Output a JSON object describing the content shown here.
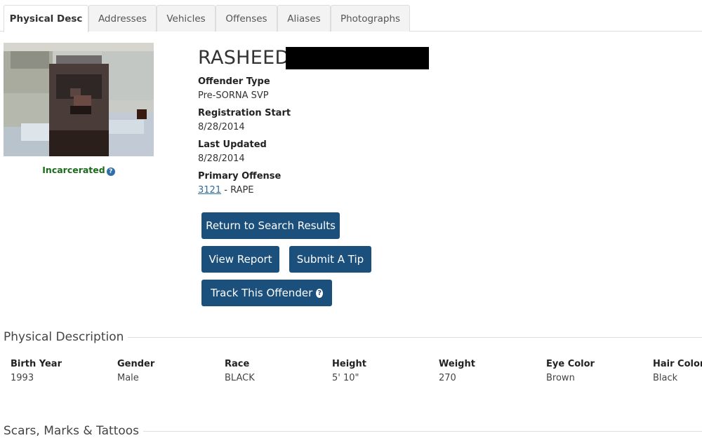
{
  "tabs": [
    {
      "label": "Physical Desc",
      "active": true
    },
    {
      "label": "Addresses",
      "active": false
    },
    {
      "label": "Vehicles",
      "active": false
    },
    {
      "label": "Offenses",
      "active": false
    },
    {
      "label": "Aliases",
      "active": false
    },
    {
      "label": "Photographs",
      "active": false
    }
  ],
  "offender": {
    "name": "RASHEED",
    "status": "Incarcerated",
    "status_help_icon": "question-circle-icon",
    "fields": {
      "offender_type": {
        "label": "Offender Type",
        "value": "Pre-SORNA SVP"
      },
      "registration_start": {
        "label": "Registration Start",
        "value": "8/28/2014"
      },
      "last_updated": {
        "label": "Last Updated",
        "value": "8/28/2014"
      },
      "primary_offense": {
        "label": "Primary Offense",
        "code": "3121",
        "separator": " - ",
        "description": "RAPE"
      }
    }
  },
  "buttons": {
    "return": "Return to Search Results",
    "view_report": "View Report",
    "submit_tip": "Submit A Tip",
    "track": "Track This Offender",
    "track_icon": "question-circle-icon"
  },
  "physical_description": {
    "title": "Physical Description",
    "columns": [
      {
        "label": "Birth Year",
        "value": "1993"
      },
      {
        "label": "Gender",
        "value": "Male"
      },
      {
        "label": "Race",
        "value": "BLACK"
      },
      {
        "label": "Height",
        "value": "5' 10\""
      },
      {
        "label": "Weight",
        "value": "270"
      },
      {
        "label": "Eye Color",
        "value": "Brown"
      },
      {
        "label": "Hair Color",
        "value": "Black"
      }
    ]
  },
  "scars": {
    "title": "Scars, Marks & Tattoos"
  },
  "colors": {
    "button_bg": "#1b4f7c",
    "status_green": "#1a6b1a",
    "link_blue": "#2c6da0"
  }
}
